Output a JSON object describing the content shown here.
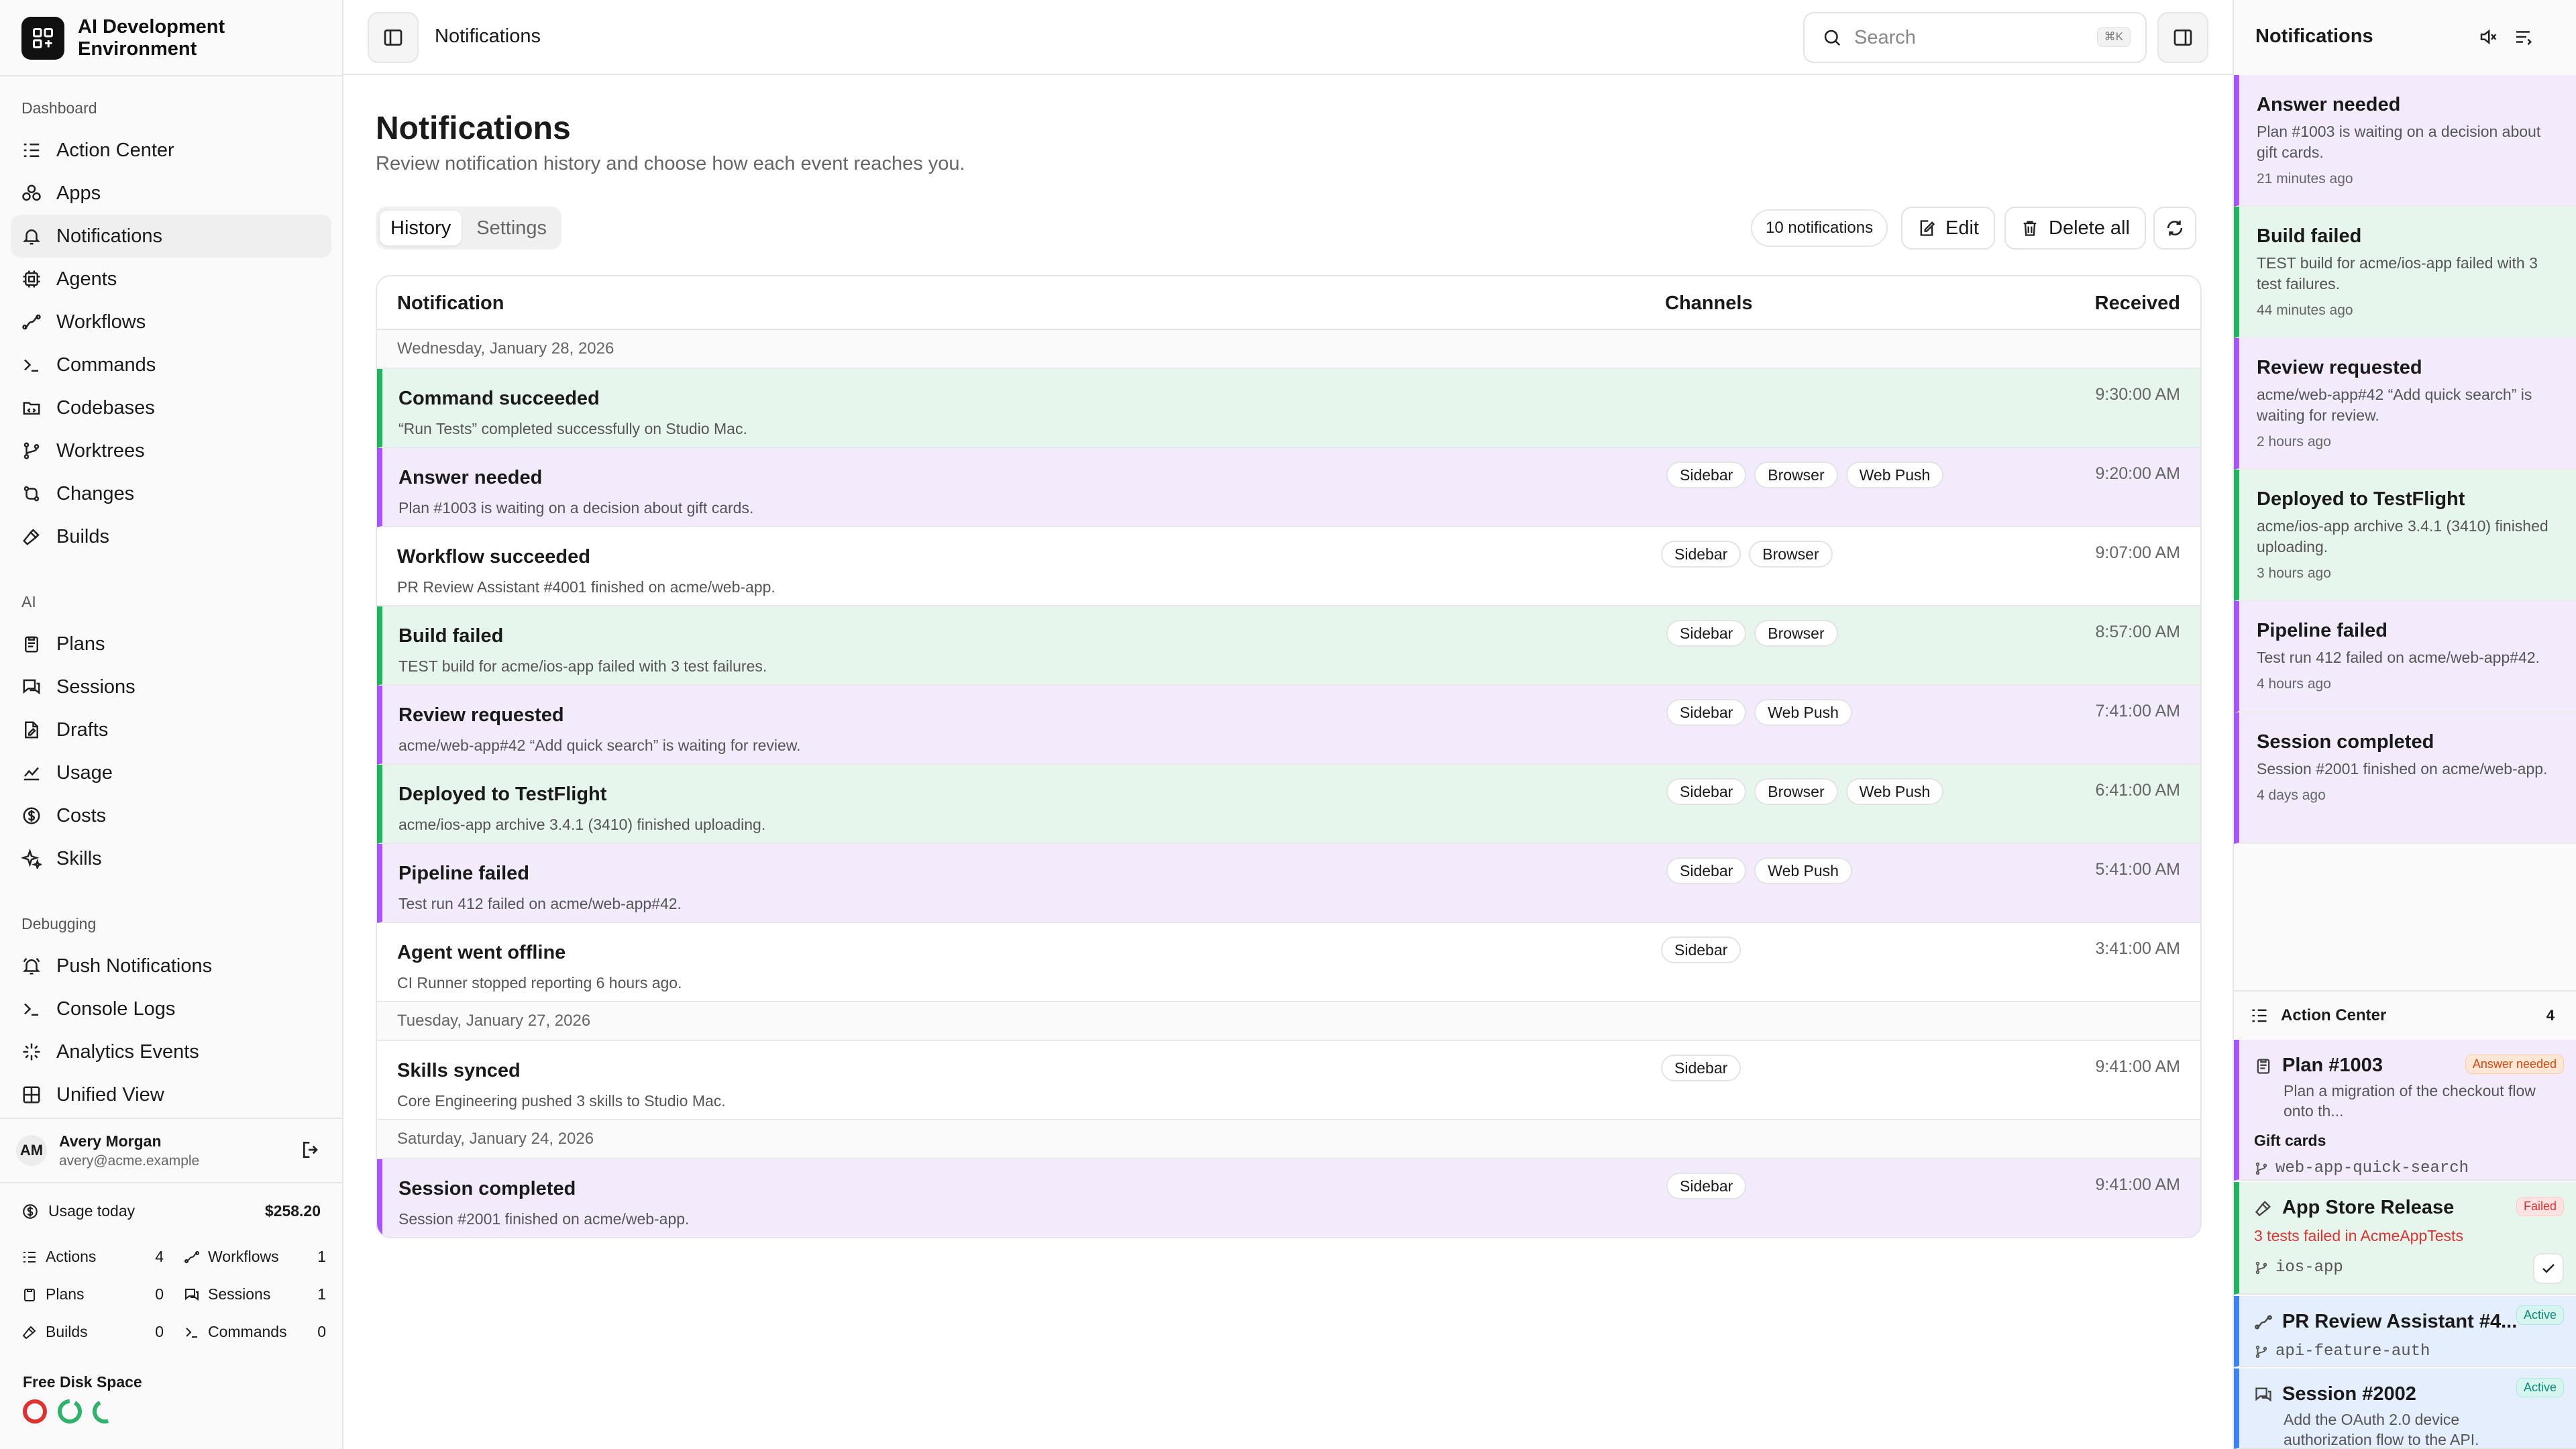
{
  "app": {
    "name": "AI Development Environment"
  },
  "sidebar": {
    "sections": {
      "dashboard": "Dashboard",
      "ai": "AI",
      "debugging": "Debugging"
    },
    "dashboard_items": [
      {
        "label": "Action Center",
        "icon": "list-check-icon"
      },
      {
        "label": "Apps",
        "icon": "apps-icon"
      },
      {
        "label": "Notifications",
        "icon": "bell-icon"
      },
      {
        "label": "Agents",
        "icon": "chip-icon"
      },
      {
        "label": "Workflows",
        "icon": "workflow-icon"
      },
      {
        "label": "Commands",
        "icon": "terminal-icon"
      },
      {
        "label": "Codebases",
        "icon": "folder-code-icon"
      },
      {
        "label": "Worktrees",
        "icon": "git-branch-icon"
      },
      {
        "label": "Changes",
        "icon": "git-compare-icon"
      },
      {
        "label": "Builds",
        "icon": "hammer-icon"
      }
    ],
    "ai_items": [
      {
        "label": "Plans",
        "icon": "clipboard-icon"
      },
      {
        "label": "Sessions",
        "icon": "chat-icon"
      },
      {
        "label": "Drafts",
        "icon": "file-edit-icon"
      },
      {
        "label": "Usage",
        "icon": "chart-icon"
      },
      {
        "label": "Costs",
        "icon": "dollar-icon"
      },
      {
        "label": "Skills",
        "icon": "sparkles-icon"
      }
    ],
    "debug_items": [
      {
        "label": "Push Notifications",
        "icon": "bell-ring-icon"
      },
      {
        "label": "Console Logs",
        "icon": "terminal-icon"
      },
      {
        "label": "Analytics Events",
        "icon": "sparkle-icon"
      },
      {
        "label": "Unified View",
        "icon": "grid-icon"
      }
    ],
    "active_item": "Notifications",
    "user": {
      "initials": "AM",
      "name": "Avery Morgan",
      "email": "avery@acme.example"
    },
    "usage": {
      "label": "Usage today",
      "value": "$258.20",
      "stats": [
        {
          "label": "Actions",
          "value": "4"
        },
        {
          "label": "Workflows",
          "value": "1"
        },
        {
          "label": "Plans",
          "value": "0"
        },
        {
          "label": "Sessions",
          "value": "1"
        },
        {
          "label": "Builds",
          "value": "0"
        },
        {
          "label": "Commands",
          "value": "0"
        }
      ]
    },
    "disk": {
      "label": "Free Disk Space",
      "colors": [
        "#e03131",
        "#2fb36a",
        "#2fb36a"
      ]
    }
  },
  "topbar": {
    "breadcrumb": "Notifications",
    "search_placeholder": "Search",
    "shortcut": "⌘K"
  },
  "main": {
    "title": "Notifications",
    "subtitle": "Review notification history and choose how each event reaches you.",
    "tabs": [
      "History",
      "Settings"
    ],
    "active_tab": "History",
    "count_label": "10 notifications",
    "edit_label": "Edit",
    "delete_label": "Delete all",
    "columns": {
      "notification": "Notification",
      "channels": "Channels",
      "received": "Received"
    },
    "groups": [
      {
        "date": "Wednesday, January 28, 2026",
        "rows": [
          {
            "title": "Command succeeded",
            "desc": "“Run Tests” completed successfully on Studio Mac.",
            "channels": [],
            "time": "9:30:00 AM",
            "tone": "green"
          },
          {
            "title": "Answer needed",
            "desc": "Plan #1003 is waiting on a decision about gift cards.",
            "channels": [
              "Sidebar",
              "Browser",
              "Web Push"
            ],
            "time": "9:20:00 AM",
            "tone": "purple"
          },
          {
            "title": "Workflow succeeded",
            "desc": "PR Review Assistant #4001 finished on acme/web-app.",
            "channels": [
              "Sidebar",
              "Browser"
            ],
            "time": "9:07:00 AM",
            "tone": "plain"
          },
          {
            "title": "Build failed",
            "desc": "TEST build for acme/ios-app failed with 3 test failures.",
            "channels": [
              "Sidebar",
              "Browser"
            ],
            "time": "8:57:00 AM",
            "tone": "green"
          },
          {
            "title": "Review requested",
            "desc": "acme/web-app#42 “Add quick search” is waiting for review.",
            "channels": [
              "Sidebar",
              "Web Push"
            ],
            "time": "7:41:00 AM",
            "tone": "purple"
          },
          {
            "title": "Deployed to TestFlight",
            "desc": "acme/ios-app archive 3.4.1 (3410) finished uploading.",
            "channels": [
              "Sidebar",
              "Browser",
              "Web Push"
            ],
            "time": "6:41:00 AM",
            "tone": "green"
          },
          {
            "title": "Pipeline failed",
            "desc": "Test run 412 failed on acme/web-app#42.",
            "channels": [
              "Sidebar",
              "Web Push"
            ],
            "time": "5:41:00 AM",
            "tone": "purple"
          },
          {
            "title": "Agent went offline",
            "desc": "CI Runner stopped reporting 6 hours ago.",
            "channels": [
              "Sidebar"
            ],
            "time": "3:41:00 AM",
            "tone": "plain"
          }
        ]
      },
      {
        "date": "Tuesday, January 27, 2026",
        "rows": [
          {
            "title": "Skills synced",
            "desc": "Core Engineering pushed 3 skills to Studio Mac.",
            "channels": [
              "Sidebar"
            ],
            "time": "9:41:00 AM",
            "tone": "plain"
          }
        ]
      },
      {
        "date": "Saturday, January 24, 2026",
        "rows": [
          {
            "title": "Session completed",
            "desc": "Session #2001 finished on acme/web-app.",
            "channels": [
              "Sidebar"
            ],
            "time": "9:41:00 AM",
            "tone": "purple"
          }
        ]
      }
    ]
  },
  "right_panel": {
    "title": "Notifications",
    "items": [
      {
        "title": "Answer needed",
        "desc": "Plan #1003 is waiting on a decision about gift cards.",
        "ago": "21 minutes ago",
        "tone": "purple"
      },
      {
        "title": "Build failed",
        "desc": "TEST build for acme/ios-app failed with 3 test failures.",
        "ago": "44 minutes ago",
        "tone": "green"
      },
      {
        "title": "Review requested",
        "desc": "acme/web-app#42 “Add quick search” is waiting for review.",
        "ago": "2 hours ago",
        "tone": "purple"
      },
      {
        "title": "Deployed to TestFlight",
        "desc": "acme/ios-app archive 3.4.1 (3410) finished uploading.",
        "ago": "3 hours ago",
        "tone": "green"
      },
      {
        "title": "Pipeline failed",
        "desc": "Test run 412 failed on acme/web-app#42.",
        "ago": "4 hours ago",
        "tone": "purple"
      },
      {
        "title": "Session completed",
        "desc": "Session #2001 finished on acme/web-app.",
        "ago": "4 days ago",
        "tone": "purple"
      }
    ],
    "action_center": {
      "title": "Action Center",
      "count": "4",
      "items": [
        {
          "title": "Plan #1003",
          "badge": "Answer needed",
          "desc": "Plan a migration of the checkout flow onto th...",
          "sub": "Gift cards",
          "branch": "web-app-quick-search"
        },
        {
          "title": "App Store Release",
          "badge": "Failed",
          "desc": "3 tests failed in AcmeAppTests",
          "branch": "ios-app"
        },
        {
          "title": "PR Review Assistant #4...",
          "badge": "Active",
          "branch": "api-feature-auth"
        },
        {
          "title": "Session #2002",
          "badge": "Active",
          "desc": "Add the OAuth 2.0 device authorization flow to the API."
        }
      ]
    }
  }
}
